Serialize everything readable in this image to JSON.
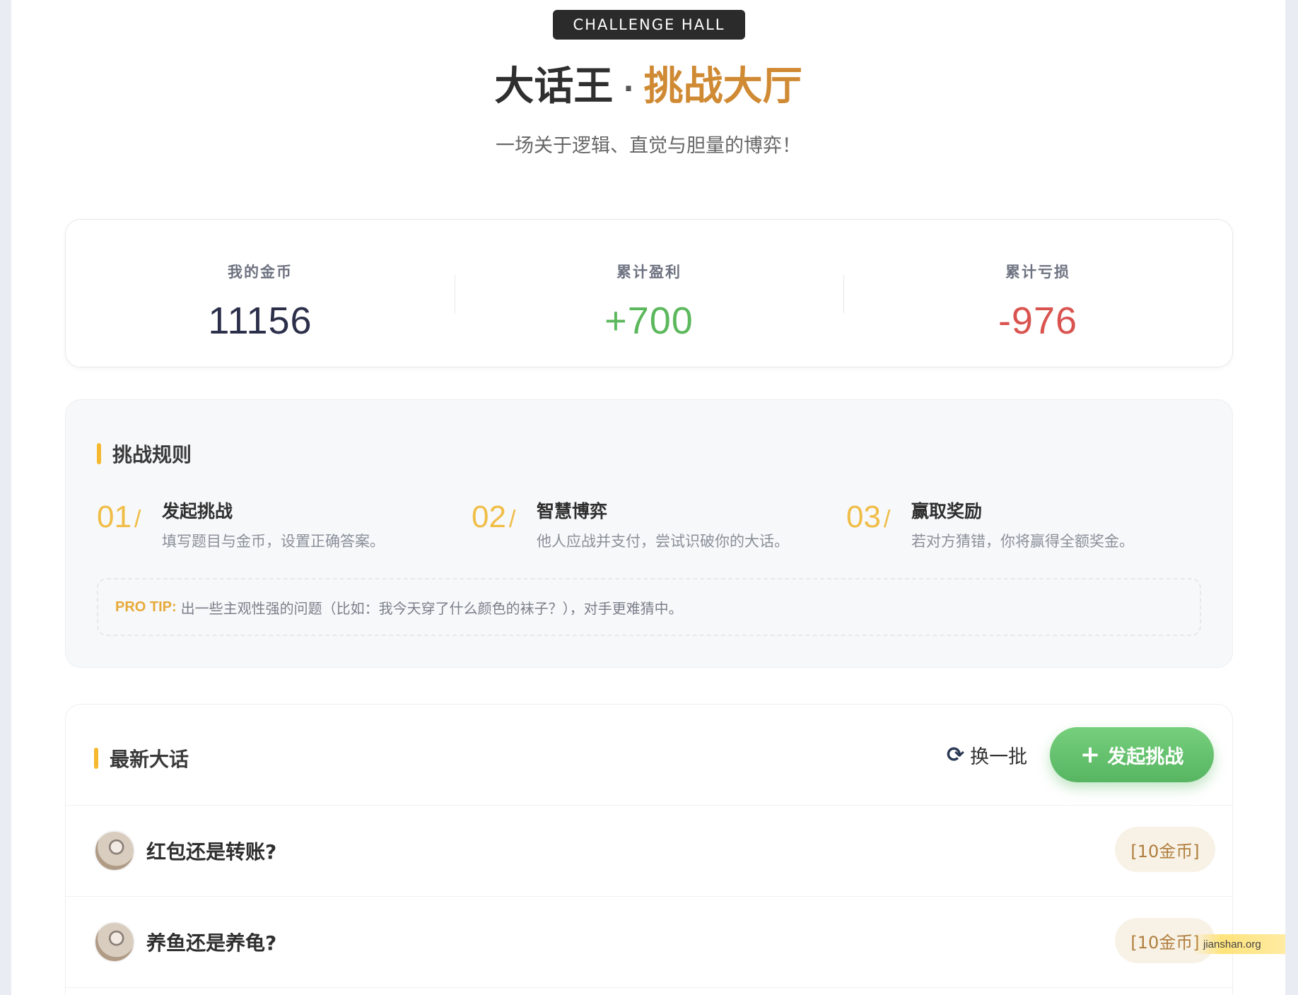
{
  "header": {
    "badge": "CHALLENGE HALL",
    "title_main": "大话王",
    "title_dot": "·",
    "title_accent": "挑战大厅",
    "subtitle": "一场关于逻辑、直觉与胆量的博弈！"
  },
  "stats": [
    {
      "label": "我的金币",
      "value": "11156",
      "color": "#2b2f4a"
    },
    {
      "label": "累计盈利",
      "value": "+700",
      "color": "#5cb85c"
    },
    {
      "label": "累计亏损",
      "value": "-976",
      "color": "#d9534f"
    }
  ],
  "rules": {
    "title": "挑战规则",
    "items": [
      {
        "num": "01",
        "slash": "/",
        "title": "发起挑战",
        "desc": "填写题目与金币，设置正确答案。"
      },
      {
        "num": "02",
        "slash": "/",
        "title": "智慧博弈",
        "desc": "他人应战并支付，尝试识破你的大话。"
      },
      {
        "num": "03",
        "slash": "/",
        "title": "赢取奖励",
        "desc": "若对方猜错，你将赢得全额奖金。"
      }
    ],
    "tip_label": "PRO TIP:",
    "tip_text": "出一些主观性强的问题（比如：我今天穿了什么颜色的袜子？），对手更难猜中。"
  },
  "latest": {
    "title": "最新大话",
    "refresh_label": "换一批",
    "launch_label": "发起挑战",
    "items": [
      {
        "title": "红包还是转账?",
        "coins": "[10金币]"
      },
      {
        "title": "养鱼还是养龟?",
        "coins": "[10金币]"
      }
    ]
  },
  "watermark": "jianshan.org",
  "colors": {
    "accent": "#d08a34",
    "highlight": "#f5b82e",
    "button": "#5cb85c"
  },
  "icons": {
    "refresh": "refresh-icon",
    "plus": "plus-icon"
  }
}
